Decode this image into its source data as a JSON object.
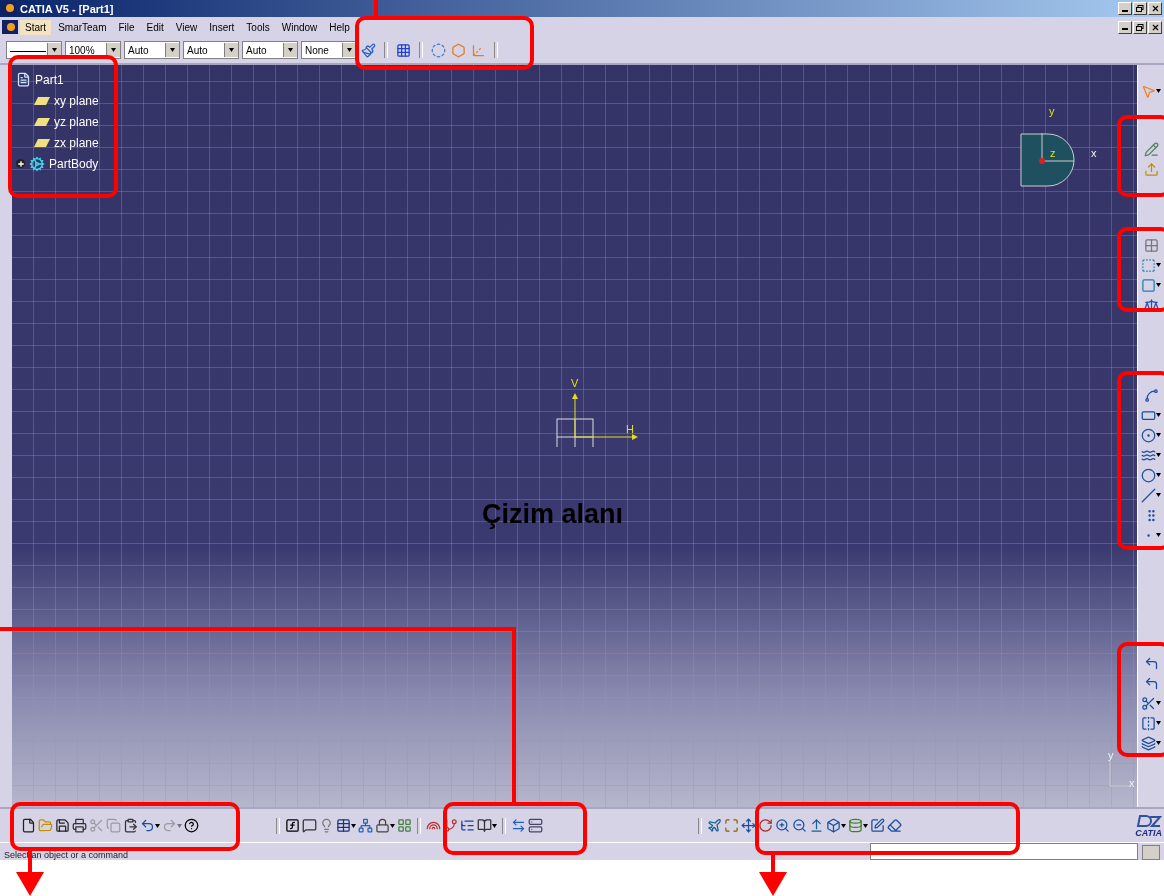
{
  "window": {
    "title": "CATIA V5 - [Part1]"
  },
  "menu": [
    {
      "label": "Start",
      "selected": true
    },
    {
      "label": "SmarTeam",
      "selected": false
    },
    {
      "label": "File",
      "selected": false
    },
    {
      "label": "Edit",
      "selected": false
    },
    {
      "label": "View",
      "selected": false
    },
    {
      "label": "Insert",
      "selected": false
    },
    {
      "label": "Tools",
      "selected": false
    },
    {
      "label": "Window",
      "selected": false
    },
    {
      "label": "Help",
      "selected": false
    }
  ],
  "toolbar": {
    "combos": [
      "100%",
      "Auto",
      "Auto",
      "Auto",
      "None"
    ]
  },
  "tree": {
    "label": "Part1",
    "children": [
      {
        "label": "xy plane"
      },
      {
        "label": "yz plane"
      },
      {
        "label": "zx plane"
      },
      {
        "label": "PartBody",
        "expanded": false
      }
    ]
  },
  "canvas": {
    "caption": "Çizim alanı",
    "axis": {
      "h": "H",
      "v": "V"
    },
    "compass": {
      "y": "y",
      "x": "x",
      "z": "z"
    },
    "corner_axis": {
      "y": "y",
      "x": "x"
    }
  },
  "status_bar": {
    "message": "Select an object or a command"
  },
  "logo": "CATIA"
}
